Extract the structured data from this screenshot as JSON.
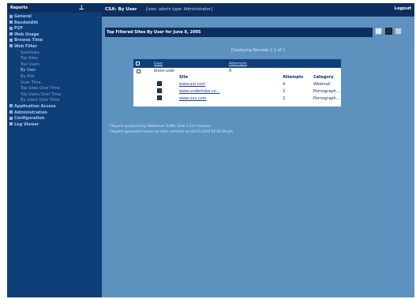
{
  "sidebar": {
    "title": "Reports",
    "items": [
      {
        "label": "General",
        "level": "top"
      },
      {
        "label": "Bandwidth",
        "level": "top"
      },
      {
        "label": "P2P",
        "level": "top"
      },
      {
        "label": "Web Usage",
        "level": "top"
      },
      {
        "label": "Browse Time",
        "level": "top"
      },
      {
        "label": "Web Filter",
        "level": "top"
      },
      {
        "label": "Summary",
        "level": "sub"
      },
      {
        "label": "Top Sites",
        "level": "sub"
      },
      {
        "label": "Top Users",
        "level": "sub"
      },
      {
        "label": "By User",
        "level": "sub",
        "active": true
      },
      {
        "label": "By Site",
        "level": "sub"
      },
      {
        "label": "Over Time",
        "level": "sub"
      },
      {
        "label": "Top Sites Over Time",
        "level": "sub"
      },
      {
        "label": "Top Users Over Time",
        "level": "sub"
      },
      {
        "label": "By Users Over Time",
        "level": "sub"
      },
      {
        "label": "Application Access",
        "level": "top"
      },
      {
        "label": "Administration",
        "level": "top"
      },
      {
        "label": "Configuration",
        "level": "top"
      },
      {
        "label": "Log Viewer",
        "level": "top"
      }
    ]
  },
  "topbar": {
    "breadcrumb": "CSA: By User",
    "user_info": "[user: admin  type: Administrator]",
    "logout": "Logout"
  },
  "report": {
    "title": "Top Filtered Sites By User for June 8, 2005",
    "display_count": "Displaying Records 1-1 of 1",
    "columns": {
      "user": "User",
      "attempts": "Attempts"
    },
    "user_row": {
      "user": "block-user",
      "attempts": "8"
    },
    "detail_columns": {
      "site": "Site",
      "attempts": "Attempts",
      "category": "Category"
    },
    "detail_rows": [
      {
        "site": "www.aol.com",
        "attempts": "4",
        "category": "Webmail"
      },
      {
        "site": "www.undertube.co...",
        "attempts": "2",
        "category": "Pornograph..."
      },
      {
        "site": "www.xxx.com",
        "attempts": "2",
        "category": "Pornograph..."
      }
    ]
  },
  "notes": [
    "* Reports produced by Websense Traffic View 2.0.0 (release)",
    "* Reports generated based on data collected on 06/11/2005 02:00:00 pm"
  ]
}
